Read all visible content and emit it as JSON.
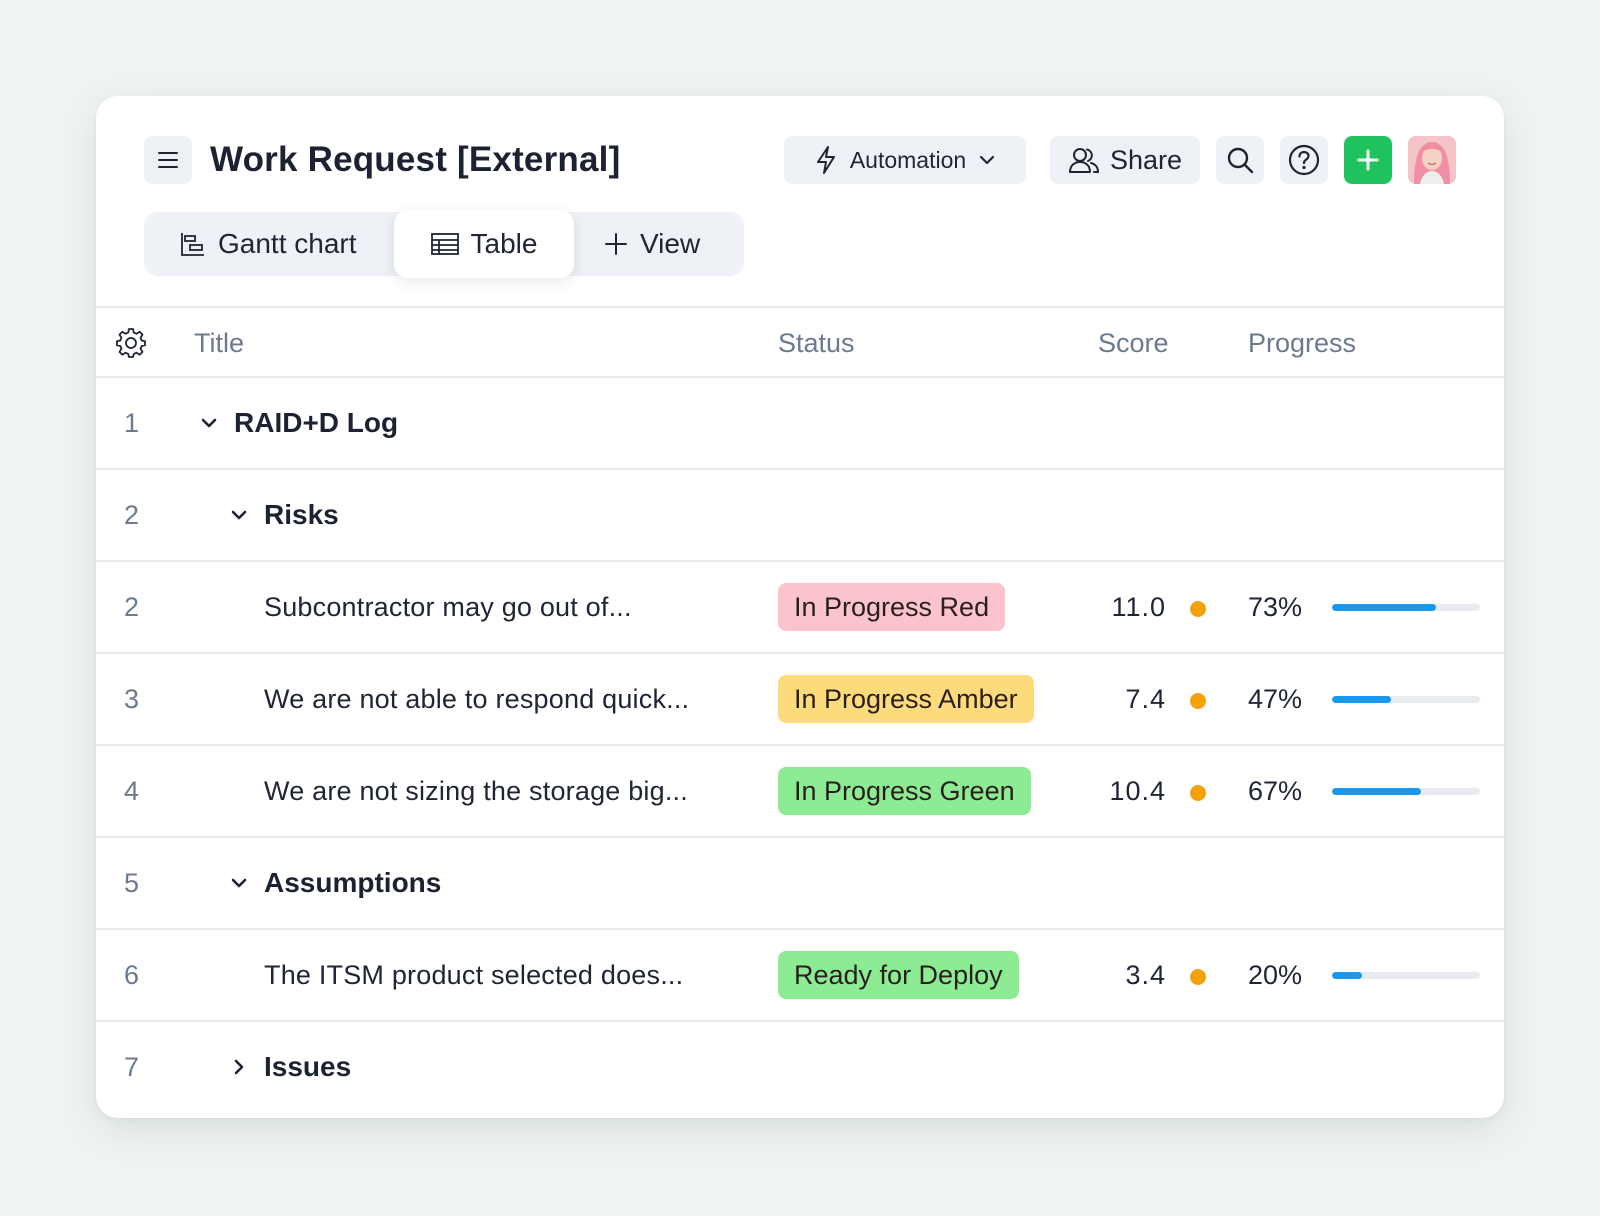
{
  "header": {
    "title": "Work Request [External]",
    "automation_label": "Automation",
    "share_label": "Share"
  },
  "icons": {
    "menu": "hamburger-icon",
    "automation": "lightning-icon",
    "share": "users-icon",
    "search": "search-icon",
    "help": "question-circle-icon",
    "add": "plus-icon"
  },
  "colors": {
    "accent_green": "#1fc45e",
    "progress_blue": "#1b97ef",
    "score_dot": "#f5a20a"
  },
  "tabs": [
    {
      "label": "Gantt chart",
      "icon": "gantt-icon",
      "active": false
    },
    {
      "label": "Table",
      "icon": "table-icon",
      "active": true
    },
    {
      "label": "View",
      "icon": "plus-icon",
      "active": false
    }
  ],
  "columns": {
    "title": "Title",
    "status": "Status",
    "score": "Score",
    "progress": "Progress"
  },
  "rows": [
    {
      "num": "1",
      "label": "RAID+D Log"
    },
    {
      "num": "2",
      "label": "Risks"
    },
    {
      "num": "2",
      "title": "Subcontractor may go out of...",
      "status": "In Progress Red",
      "status_color": "#fbc3cc",
      "score": "11.0",
      "progress_label": "73%",
      "progress": 0.7
    },
    {
      "num": "3",
      "title": "We are not able to respond quick...",
      "status": "In Progress Amber",
      "status_color": "#fddb7c",
      "score": "7.4",
      "progress_label": "47%",
      "progress": 0.4
    },
    {
      "num": "4",
      "title": "We are not sizing the storage big...",
      "status": "In Progress Green",
      "status_color": "#8ceb93",
      "score": "10.4",
      "progress_label": "67%",
      "progress": 0.6
    },
    {
      "num": "5",
      "label": "Assumptions"
    },
    {
      "num": "6",
      "title": "The ITSM product selected does...",
      "status": "Ready for Deploy",
      "status_color": "#8ceb93",
      "score": "3.4",
      "progress_label": "20%",
      "progress": 0.2
    },
    {
      "num": "7",
      "label": "Issues"
    }
  ]
}
